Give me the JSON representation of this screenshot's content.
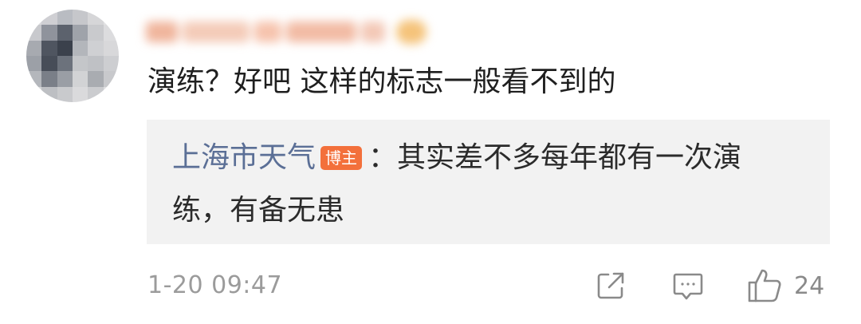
{
  "comment": {
    "author": "",
    "text": "演练？好吧 这样的标志一般看不到的"
  },
  "reply": {
    "author": "上海市天气",
    "badge": "博主",
    "separator": "：",
    "text_line1": "其实差不多每年都有一次演",
    "text_line2": "练，有备无患"
  },
  "footer": {
    "timestamp": "1-20 09:47",
    "like_count": "24"
  },
  "icons": {
    "share": "share-icon",
    "reply": "comment-icon",
    "like": "thumbs-up-icon"
  },
  "colors": {
    "reply_author": "#5b6f96",
    "badge_bg": "#f3703b",
    "reply_bg": "#f2f2f2",
    "meta": "#9b9b9b"
  }
}
